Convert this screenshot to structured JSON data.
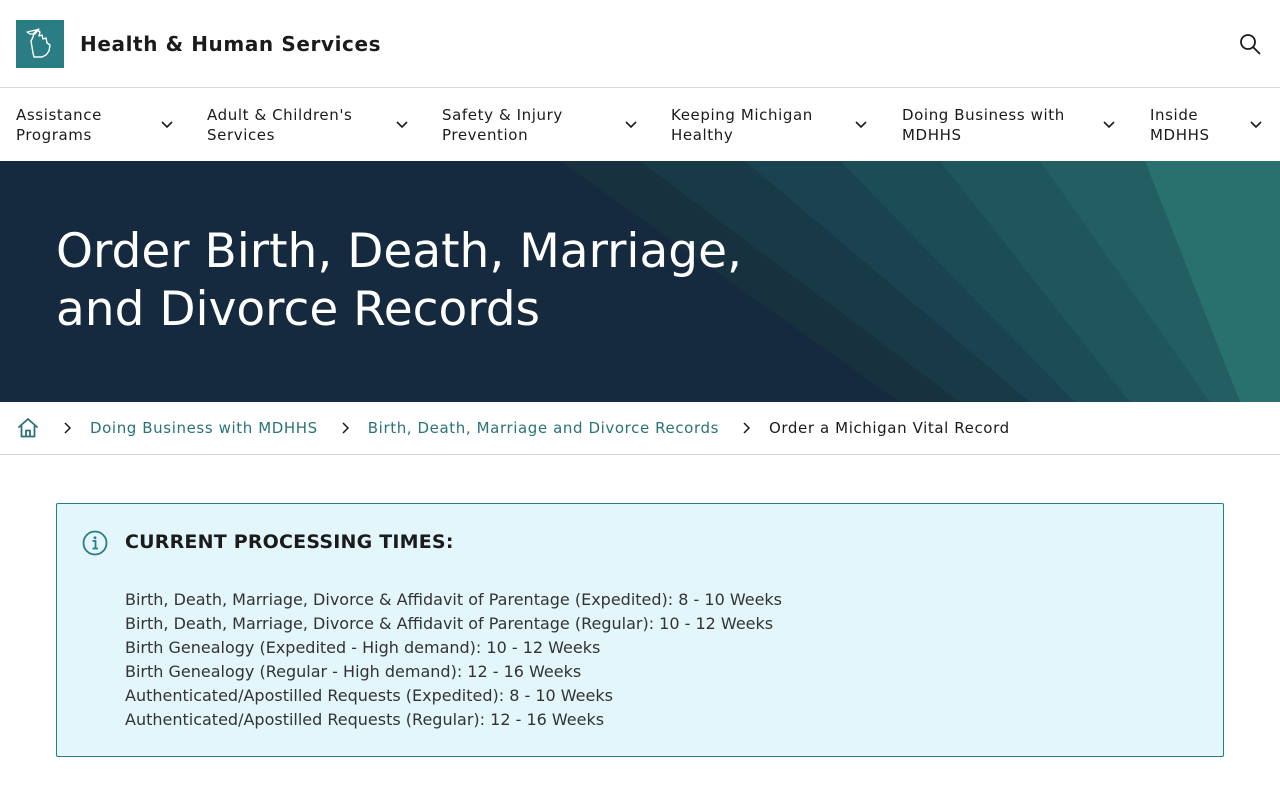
{
  "header": {
    "site_title": "Health & Human Services",
    "logo_icon": "michigan-state-icon",
    "search_icon": "search-icon",
    "brand_color": "#2a7d82"
  },
  "nav": {
    "items": [
      {
        "label": "Assistance\nPrograms"
      },
      {
        "label": "Adult & Children's\nServices"
      },
      {
        "label": "Safety & Injury\nPrevention"
      },
      {
        "label": "Keeping Michigan\nHealthy"
      },
      {
        "label": "Doing Business with\nMDHHS"
      },
      {
        "label": "Inside\nMDHHS"
      }
    ]
  },
  "hero": {
    "title": "Order Birth, Death, Marriage, and Divorce Records",
    "background_color": "#152a3f"
  },
  "breadcrumb": {
    "home_icon": "home-icon",
    "links": [
      {
        "label": "Doing Business with MDHHS"
      },
      {
        "label": "Birth, Death, Marriage and Divorce Records"
      }
    ],
    "current": "Order a Michigan Vital Record",
    "link_color": "#2a7379"
  },
  "alert": {
    "icon": "info-icon",
    "heading": "CURRENT PROCESSING TIMES:",
    "background_color": "#e2f6fc",
    "items": [
      "Birth, Death, Marriage, Divorce & Affidavit of Parentage (Expedited): 8 - 10 Weeks",
      "Birth, Death, Marriage, Divorce & Affidavit of Parentage (Regular): 10 - 12 Weeks",
      "Birth Genealogy (Expedited - High demand): 10 - 12 Weeks",
      "Birth Genealogy (Regular - High demand): 12 - 16 Weeks",
      "Authenticated/Apostilled Requests (Expedited): 8 - 10 Weeks",
      "Authenticated/Apostilled Requests (Regular): 12 - 16 Weeks"
    ]
  }
}
